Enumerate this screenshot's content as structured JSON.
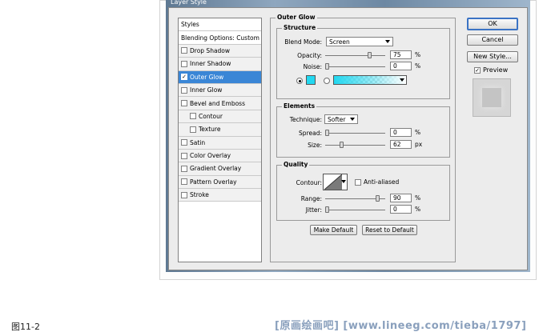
{
  "window": {
    "title": "Layer Style"
  },
  "styles_list": {
    "header": "Styles",
    "blending": "Blending Options: Custom",
    "items": [
      {
        "label": "Drop Shadow",
        "checked": false,
        "indent": false
      },
      {
        "label": "Inner Shadow",
        "checked": false,
        "indent": false
      },
      {
        "label": "Outer Glow",
        "checked": true,
        "indent": false,
        "selected": true
      },
      {
        "label": "Inner Glow",
        "checked": false,
        "indent": false
      },
      {
        "label": "Bevel and Emboss",
        "checked": false,
        "indent": false
      },
      {
        "label": "Contour",
        "checked": false,
        "indent": true
      },
      {
        "label": "Texture",
        "checked": false,
        "indent": true
      },
      {
        "label": "Satin",
        "checked": false,
        "indent": false
      },
      {
        "label": "Color Overlay",
        "checked": false,
        "indent": false
      },
      {
        "label": "Gradient Overlay",
        "checked": false,
        "indent": false
      },
      {
        "label": "Pattern Overlay",
        "checked": false,
        "indent": false
      },
      {
        "label": "Stroke",
        "checked": false,
        "indent": false
      }
    ]
  },
  "outer_glow": {
    "title": "Outer Glow",
    "structure": {
      "title": "Structure",
      "blend_mode_label": "Blend Mode:",
      "blend_mode_value": "Screen",
      "opacity_label": "Opacity:",
      "opacity_value": "75",
      "opacity_level": 0.75,
      "noise_label": "Noise:",
      "noise_value": "0",
      "noise_level": 0,
      "percent": "%",
      "glow_color": "#22d8f0"
    },
    "elements": {
      "title": "Elements",
      "technique_label": "Technique:",
      "technique_value": "Softer",
      "spread_label": "Spread:",
      "spread_value": "0",
      "spread_level": 0,
      "size_label": "Size:",
      "size_value": "62",
      "size_level": 0.25,
      "percent": "%",
      "px": "px"
    },
    "quality": {
      "title": "Quality",
      "contour_label": "Contour:",
      "anti_aliased_label": "Anti-aliased",
      "anti_aliased_checked": false,
      "range_label": "Range:",
      "range_value": "90",
      "range_level": 0.9,
      "jitter_label": "Jitter:",
      "jitter_value": "0",
      "jitter_level": 0,
      "percent": "%"
    },
    "make_default": "Make Default",
    "reset_default": "Reset to Default"
  },
  "buttons": {
    "ok": "OK",
    "cancel": "Cancel",
    "new_style": "New Style...",
    "preview_label": "Preview",
    "preview_checked": true
  },
  "caption": "图11-2",
  "watermark": "[原画绘画吧] [www.lineeg.com/tieba/1797]"
}
